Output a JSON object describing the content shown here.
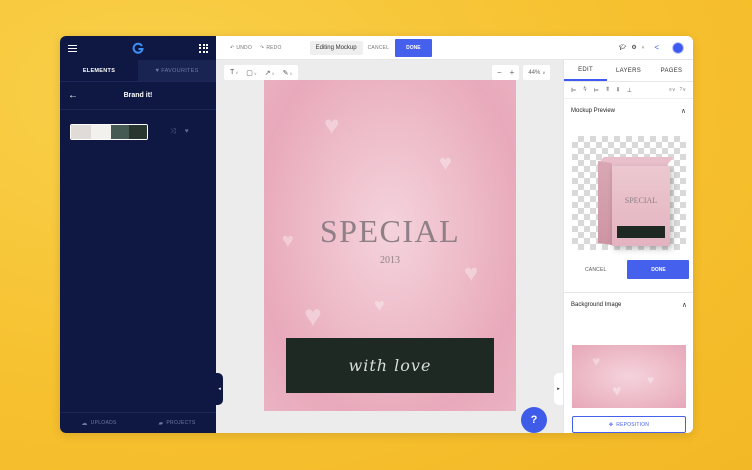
{
  "sidebar": {
    "tabs": [
      {
        "label": "ELEMENTS"
      },
      {
        "label": "FAVOURITES"
      }
    ],
    "section_title": "Brand it!",
    "palette_colors": [
      "#e0dbd6",
      "#f3f1ee",
      "#ffffff",
      "#455a53",
      "#29352f"
    ],
    "bottom": [
      {
        "label": "UPLOADS",
        "icon": "cloud-upload-icon"
      },
      {
        "label": "PROJECTS",
        "icon": "folder-icon"
      }
    ]
  },
  "toolbar": {
    "undo_label": "UNDO",
    "redo_label": "REDO",
    "editing_label": "Editing Mockup",
    "cancel_label": "CANCEL",
    "done_label": "DONE"
  },
  "canvas_tools": {
    "text_glyph": "T",
    "zoom_minus": "−",
    "zoom_plus": "+",
    "zoom_level": "44%"
  },
  "design": {
    "title": "SPECIAL",
    "year": "2013",
    "tagline": "with love"
  },
  "help": {
    "label": "?"
  },
  "right_panel": {
    "tabs": [
      {
        "label": "EDIT"
      },
      {
        "label": "LAYERS"
      },
      {
        "label": "PAGES"
      }
    ],
    "mockup_preview": {
      "title": "Mockup Preview",
      "box_title": "SPECIAL",
      "cancel_label": "CANCEL",
      "done_label": "DONE"
    },
    "background_image": {
      "title": "Background Image",
      "reposition_label": "REPOSITION"
    }
  },
  "colors": {
    "accent": "#4660ee",
    "sidebar_bg": "#0e1842",
    "page_bg": "#f7c435"
  }
}
